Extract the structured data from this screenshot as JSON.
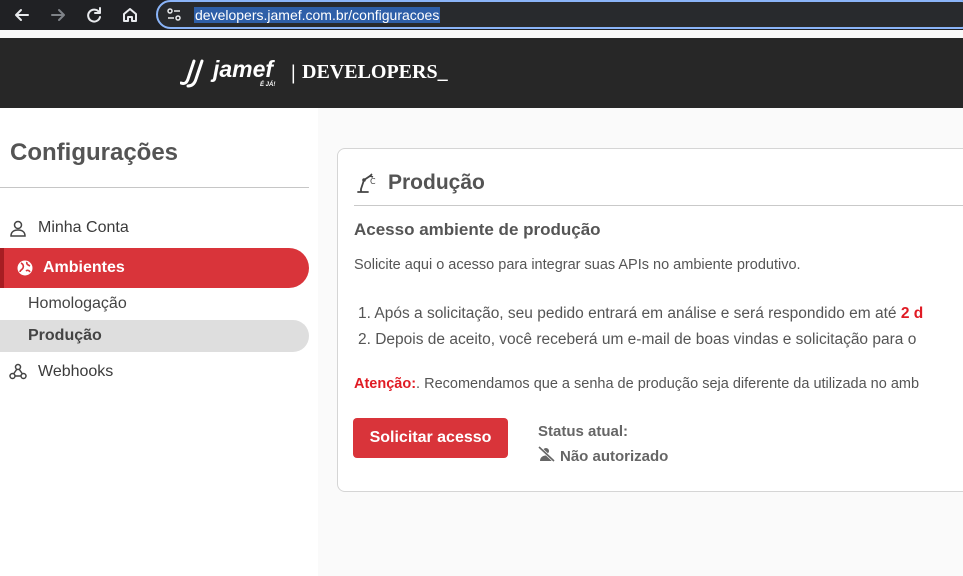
{
  "browser": {
    "url": "developers.jamef.com.br/configuracoes",
    "back_icon": "arrow-left-icon",
    "forward_icon": "arrow-right-icon",
    "reload_icon": "reload-icon",
    "home_icon": "home-icon"
  },
  "header": {
    "logo_text": "jamef",
    "logo_tagline": "É JÁ!",
    "separator": "|",
    "site_title": "DEVELOPERS_"
  },
  "sidebar": {
    "title": "Configurações",
    "items": [
      {
        "label": "Minha Conta",
        "icon": "user-icon"
      },
      {
        "label": "Ambientes",
        "icon": "globe-icon"
      },
      {
        "label": "Homologação"
      },
      {
        "label": "Produção"
      },
      {
        "label": "Webhooks",
        "icon": "webhook-icon"
      }
    ]
  },
  "card": {
    "title": "Produção",
    "title_icon": "robot-arm-icon",
    "subtitle": "Acesso ambiente de produção",
    "description": "Solicite aqui o acesso para integrar suas APIs no ambiente produtivo.",
    "step1_prefix": "1. Após a solicitação, seu pedido entrará em análise e será respondido em até ",
    "step1_highlight": "2 d",
    "step2": "2. Depois de aceito, você receberá um e-mail de boas vindas e solicitação para o",
    "attention_label": "Atenção:",
    "attention_text": ". Recomendamos que a senha de produção seja diferente da utilizada no amb",
    "request_button": "Solicitar acesso",
    "status_label": "Status atual:",
    "status_value": "Não autorizado",
    "status_icon": "user-slash-icon"
  },
  "colors": {
    "accent": "#d9343a",
    "header_bg": "#272727",
    "warning_text": "#e01b24"
  }
}
